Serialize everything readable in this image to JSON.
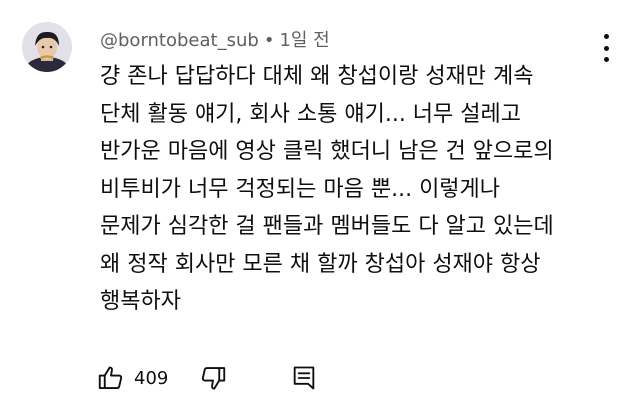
{
  "comment": {
    "author": "@borntobeat_sub",
    "separator": "•",
    "time": "1일 전",
    "lines": [
      "걍 존나 답답하다 대체 왜 창섭이랑 성재만 계속",
      "단체 활동 얘기, 회사 소통 얘기... 너무 설레고",
      "반가운 마음에 영상 클릭 했더니 남은 건 앞으로의",
      "비투비가 너무 걱정되는 마음 뿐... 이렇게나",
      "문제가 심각한 걸 팬들과 멤버들도 다 알고 있는데",
      "왜 정작 회사만 모른 채 할까 창섭아 성재야 항상",
      "행복하자"
    ],
    "like_count": "409"
  },
  "icons": {
    "like": "thumbs-up-icon",
    "dislike": "thumbs-down-icon",
    "reply": "comment-reply-icon",
    "menu": "more-vert-icon"
  },
  "colors": {
    "text": "#0f0f0f",
    "meta": "#606060",
    "background": "#ffffff"
  }
}
